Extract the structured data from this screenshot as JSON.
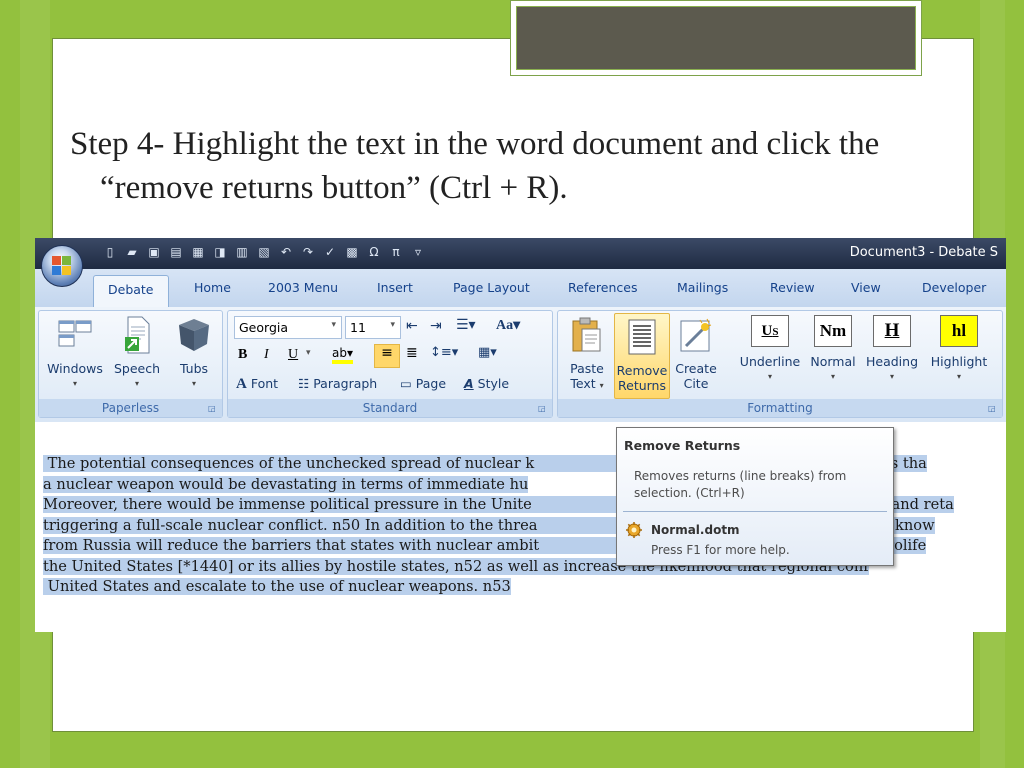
{
  "slide": {
    "step_text": "Step 4- Highlight the text in the word document and click the “remove returns button” (Ctrl + R)."
  },
  "word": {
    "window_title": "Document3 - Debate S",
    "tabs": [
      "Debate",
      "Home",
      "2003 Menu",
      "Insert",
      "Page Layout",
      "References",
      "Mailings",
      "Review",
      "View",
      "Developer"
    ],
    "active_tab": "Debate",
    "groups": {
      "paperless": {
        "label": "Paperless",
        "buttons": [
          "Windows",
          "Speech",
          "Tubs"
        ]
      },
      "standard": {
        "label": "Standard",
        "font_name": "Georgia",
        "font_size": "11",
        "bold": "B",
        "italic": "I",
        "underline": "U",
        "font_button": "Font",
        "paragraph_button": "Paragraph",
        "page_button": "Page",
        "style_button": "Style",
        "change_case": "Aa",
        "highlight": "ab"
      },
      "formatting": {
        "label": "Formatting",
        "paste_text": [
          "Paste",
          "Text"
        ],
        "remove_returns": [
          "Remove",
          "Returns"
        ],
        "create_cite": [
          "Create",
          "Cite"
        ],
        "underline": "Underline",
        "normal": "Normal",
        "heading": "Heading",
        "highlight": "Highlight",
        "style_marks": {
          "underline": "U",
          "underline_sub": "S",
          "normal": "Nm",
          "heading": "H",
          "highlight": "hl"
        }
      }
    },
    "document_lines": [
      "The potential consequences of the unchecked spread of nuclear k",
      "a nuclear weapon would be devastating in terms of immediate hu",
      "Moreover, there would be immense political pressure in the Unite",
      "triggering a full-scale nuclear conflict. n50 In addition to the threa",
      "from Russia will reduce the barriers that states with nuclear ambit",
      "the United States  [*1440]  or its allies by hostile states, n52 as well as increase the likelihood that regional conf",
      "United States and escalate to the use of nuclear weapons. n53"
    ],
    "document_lines_right": [
      "ist groups tha",
      "",
      "tors and reta",
      "nuclear know",
      "pread prolife",
      "",
      ""
    ],
    "tooltip": {
      "title": "Remove Returns",
      "description": "Removes returns (line breaks) from selection. (Ctrl+R)",
      "template": "Normal.dotm",
      "help": "Press F1 for more help."
    }
  },
  "colors": {
    "background": "#93c13e",
    "titlebar": "#1f2b42",
    "selection": "#b9cfeb",
    "ribbon_text": "#15428b"
  }
}
